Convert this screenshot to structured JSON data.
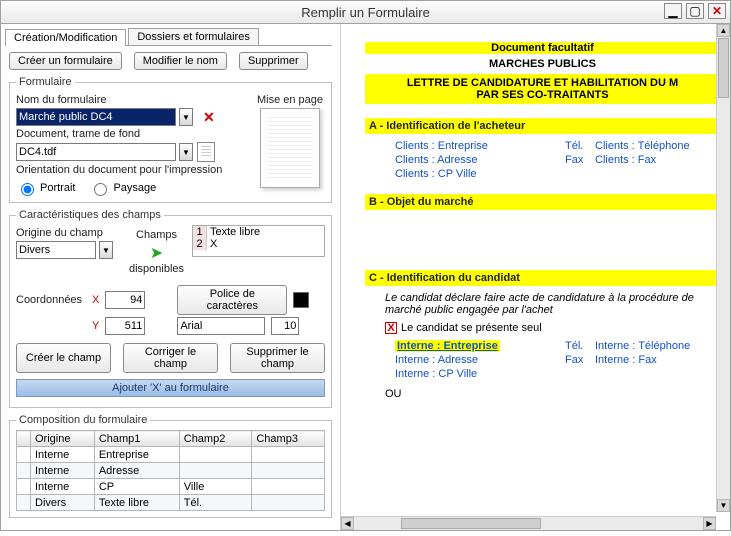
{
  "window": {
    "title": "Remplir un Formulaire"
  },
  "tabs": {
    "create": "Création/Modification",
    "dossiers": "Dossiers et formulaires"
  },
  "toolbar": {
    "create": "Créer un formulaire",
    "rename": "Modifier le nom",
    "delete": "Supprimer"
  },
  "form": {
    "legend": "Formulaire",
    "name_label": "Nom du formulaire",
    "name_value": "Marché public DC4",
    "doc_label": "Document, trame de fond",
    "doc_value": "DC4.tdf",
    "mise_label": "Mise en page",
    "orient_label": "Orientation du document pour l'impression",
    "portrait": "Portrait",
    "paysage": "Paysage"
  },
  "chars": {
    "legend": "Caractéristiques des champs",
    "origine_label": "Origine du champ",
    "origine_value": "Divers",
    "champs_label": "Champs",
    "disponibles": "disponibles",
    "field1_idx": "1",
    "field1_txt": "Texte libre",
    "field2_idx": "2",
    "field2_txt": "X",
    "coord_label": "Coordonnées",
    "x_label": "X",
    "y_label": "Y",
    "x_val": "94",
    "y_val": "511",
    "police_btn": "Police de caractères",
    "font_name": "Arial",
    "font_size": "10",
    "create_field": "Créer le champ",
    "fix_field": "Corriger le champ",
    "delete_field": "Supprimer le champ",
    "add_bar": "Ajouter 'X' au formulaire"
  },
  "comp": {
    "legend": "Composition du formulaire",
    "hdr_origine": "Origine",
    "hdr_c1": "Champ1",
    "hdr_c2": "Champ2",
    "hdr_c3": "Champ3",
    "rows": [
      {
        "o": "Interne",
        "c1": "Entreprise",
        "c2": "",
        "c3": ""
      },
      {
        "o": "Interne",
        "c1": "Adresse",
        "c2": "",
        "c3": ""
      },
      {
        "o": "Interne",
        "c1": "CP",
        "c2": "Ville",
        "c3": ""
      },
      {
        "o": "Divers",
        "c1": "Texte libre",
        "c2": "Tél.",
        "c3": ""
      }
    ]
  },
  "preview": {
    "doc_facultatif": "Document facultatif",
    "marches": "MARCHES PUBLICS",
    "lettre1": "LETTRE DE CANDIDATURE ET HABILITATION DU M",
    "lettre2": "PAR SES CO-TRAITANTS",
    "sectA": "A - Identification de l'acheteur",
    "clients_ent": "Clients : Entreprise",
    "clients_adr": "Clients : Adresse",
    "clients_cpv": "Clients : CP Ville",
    "tel_label": "Tél.",
    "fax_label": "Fax",
    "clients_tel": "Clients : Téléphone",
    "clients_fax": "Clients : Fax",
    "sectB": "B - Objet du marché",
    "sectC": "C - Identification du candidat",
    "ital": "Le candidat déclare faire acte de candidature à la procédure de marché public engagée par l'achet",
    "seul": "Le candidat se présente seul",
    "int_ent": "Interne : Entreprise",
    "int_adr": "Interne : Adresse",
    "int_cpv": "Interne : CP Ville",
    "int_tel": "Interne : Téléphone",
    "int_fax": "Interne : Fax",
    "ou": "OU"
  }
}
